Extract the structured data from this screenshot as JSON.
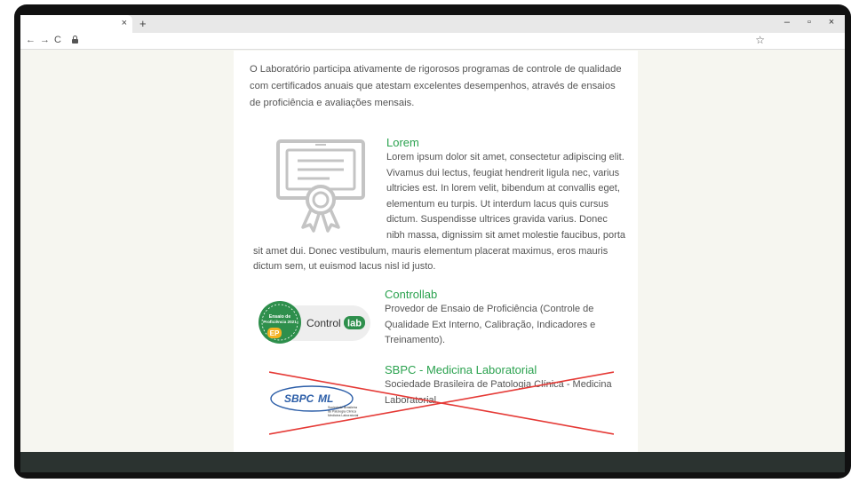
{
  "browser": {
    "tab_close": "×",
    "new_tab": "+",
    "nav": {
      "back": "←",
      "forward": "→",
      "reload": "C"
    },
    "bookmark": "☆",
    "window_controls": {
      "minimize": "–",
      "restore": "▫",
      "close": "×"
    }
  },
  "page": {
    "intro": "O Laboratório participa ativamente de rigorosos programas de controle de qualidade com certificados anuais que atestam excelentes desempenhos, através de ensaios de proficiência e avaliações mensais.",
    "lorem": {
      "title": "Lorem",
      "text": "Lorem ipsum dolor sit amet, consectetur adipiscing elit. Vivamus dui lectus, feugiat hendrerit ligula nec, varius ultricies est. In lorem velit, bibendum at convallis eget, elementum eu turpis. Ut interdum lacus quis cursus dictum. Suspendisse ultrices gravida varius. Donec nibh massa, dignissim sit amet molestie faucibus, porta sit amet dui. Donec vestibulum, mauris elementum placerat maximus, eros mauris dictum sem, ut euismod lacus nisl id justo."
    },
    "controllab": {
      "title": "Controllab",
      "text": "Provedor de Ensaio de Proficiência (Controle de Qualidade Ext Interno, Calibração, Indicadores e Treinamento).",
      "logo": {
        "badge_line1": "Ensaio de",
        "badge_line2": "Proficiência 2021",
        "badge_tag": "EP",
        "wordmark": "Control",
        "wordmark_tail": "lab"
      }
    },
    "sbpc": {
      "title": "SBPC - Medicina Laboratorial",
      "text": "Sociedade Brasileira de Patologia Clínica - Medicina Laboratorial.",
      "logo": {
        "wordmark": "SBPC",
        "wordmark_tail": "ML",
        "sub1": "Sociedade Brasileira",
        "sub2": "de Patologia Clínica",
        "sub3": "Medicina Laboratorial"
      },
      "crossed_out": true
    }
  },
  "colors": {
    "accent_green": "#2ba24f",
    "strike_red": "#e53935",
    "footer": "#2b3330",
    "page_bg": "#f6f6f0"
  }
}
